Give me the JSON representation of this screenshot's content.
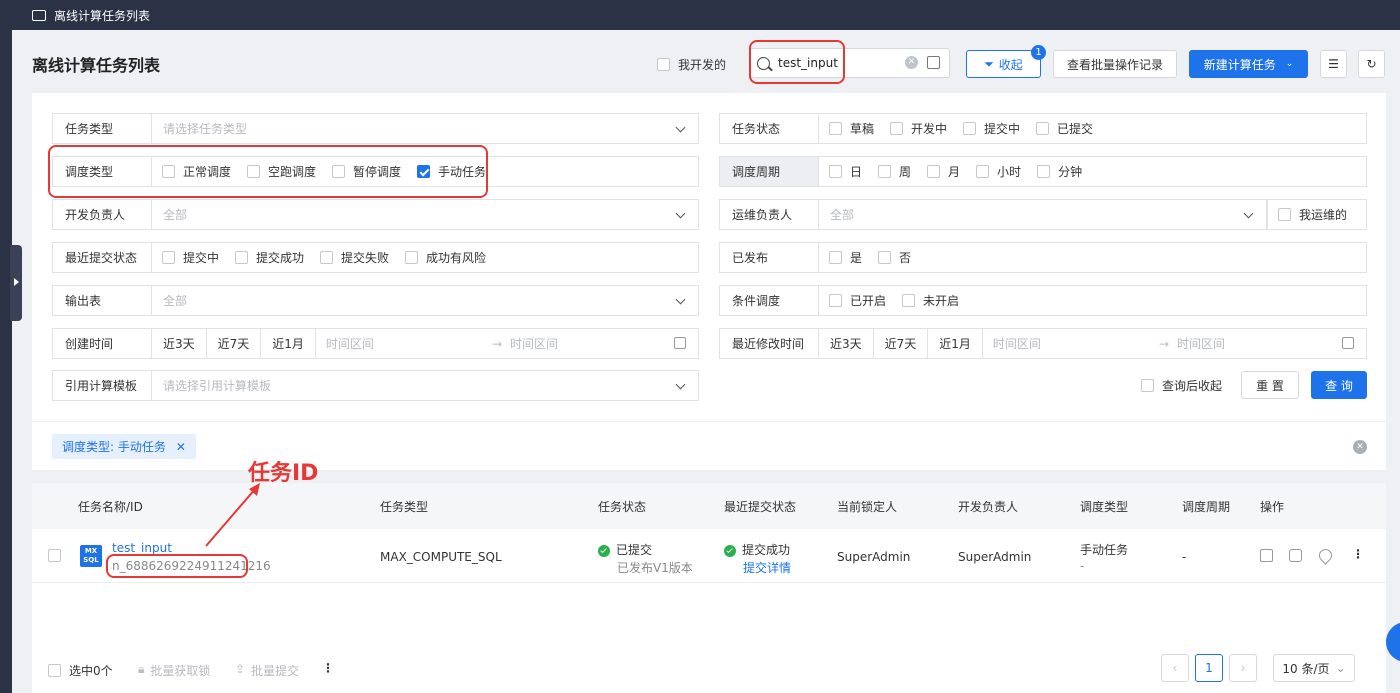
{
  "window": {
    "title": "离线计算任务列表"
  },
  "page": {
    "title": "离线计算任务列表",
    "my_dev_label": "我开发的"
  },
  "search": {
    "value": "test_input"
  },
  "toolbar": {
    "collapse": "收起",
    "collapse_badge": "1",
    "batch_log": "查看批量操作记录",
    "new_task": "新建计算任务"
  },
  "filters": {
    "task_type": {
      "label": "任务类型",
      "placeholder": "请选择任务类型"
    },
    "task_status": {
      "label": "任务状态",
      "options": [
        "草稿",
        "开发中",
        "提交中",
        "已提交"
      ]
    },
    "schedule_type": {
      "label": "调度类型",
      "options": [
        "正常调度",
        "空跑调度",
        "暂停调度",
        "手动任务"
      ],
      "checked": "手动任务"
    },
    "schedule_cycle": {
      "label": "调度周期",
      "options": [
        "日",
        "周",
        "月",
        "小时",
        "分钟"
      ]
    },
    "dev_owner": {
      "label": "开发负责人",
      "placeholder": "全部"
    },
    "ops_owner": {
      "label": "运维负责人",
      "placeholder": "全部",
      "mine": "我运维的"
    },
    "last_submit": {
      "label": "最近提交状态",
      "options": [
        "提交中",
        "提交成功",
        "提交失败",
        "成功有风险"
      ]
    },
    "published": {
      "label": "已发布",
      "options": [
        "是",
        "否"
      ]
    },
    "output_table": {
      "label": "输出表",
      "placeholder": "全部"
    },
    "conditional": {
      "label": "条件调度",
      "options": [
        "已开启",
        "未开启"
      ]
    },
    "created": {
      "label": "创建时间",
      "quick": [
        "近3天",
        "近7天",
        "近1月"
      ],
      "start": "时间区间",
      "end": "时间区间"
    },
    "modified": {
      "label": "最近修改时间",
      "quick": [
        "近3天",
        "近7天",
        "近1月"
      ],
      "start": "时间区间",
      "end": "时间区间"
    },
    "template": {
      "label": "引用计算模板",
      "placeholder": "请选择引用计算模板"
    },
    "collapse_after": "查询后收起",
    "reset": "重 置",
    "query": "查 询"
  },
  "active_tag": "调度类型: 手动任务",
  "annotation": "任务ID",
  "table": {
    "headers": [
      "任务名称/ID",
      "任务类型",
      "任务状态",
      "最近提交状态",
      "当前锁定人",
      "开发负责人",
      "调度类型",
      "调度周期",
      "操作"
    ],
    "rows": [
      {
        "icon_text": "MX SQL",
        "name": "test_input",
        "id": "n_6886269224911241216",
        "type": "MAX_COMPUTE_SQL",
        "status": "已提交",
        "status_sub": "已发布V1版本",
        "submit": "提交成功",
        "submit_link": "提交详情",
        "locker": "SuperAdmin",
        "owner": "SuperAdmin",
        "schedule_type": "手动任务",
        "schedule_type_sub": "-",
        "cycle": "-"
      }
    ]
  },
  "footer": {
    "selected": "选中0个",
    "batch_lock": "批量获取锁",
    "batch_submit": "批量提交",
    "page": "1",
    "page_size": "10 条/页"
  }
}
